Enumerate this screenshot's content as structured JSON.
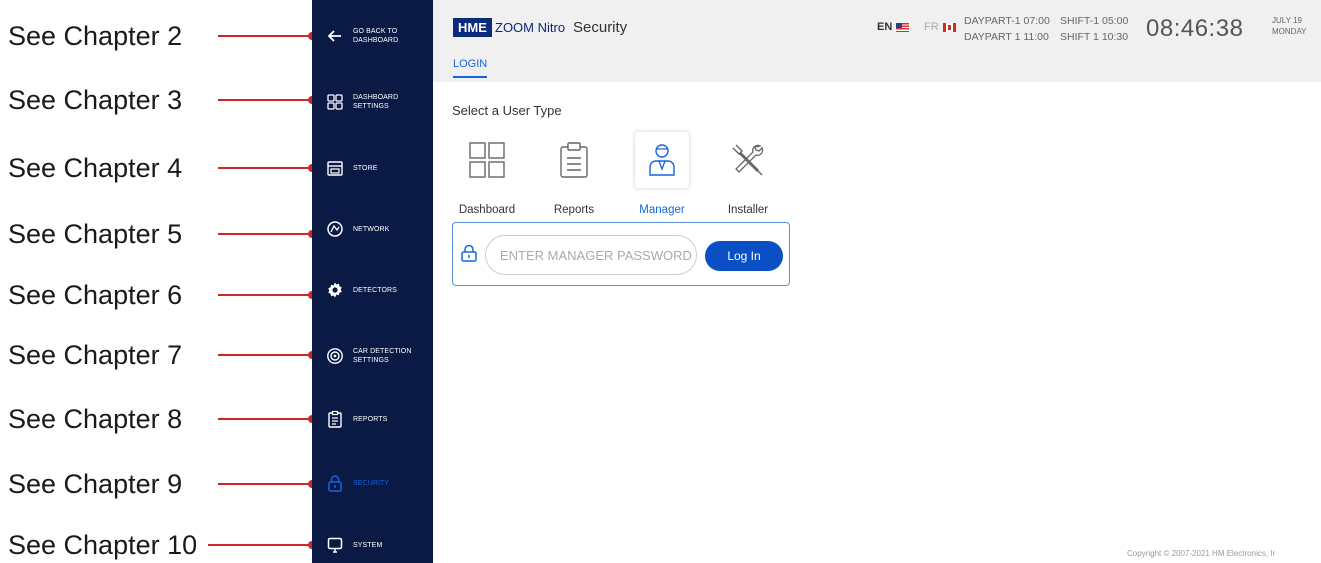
{
  "callouts": [
    {
      "label": "See Chapter 2"
    },
    {
      "label": "See Chapter 3"
    },
    {
      "label": "See Chapter 4"
    },
    {
      "label": "See Chapter 5"
    },
    {
      "label": "See Chapter 6"
    },
    {
      "label": "See Chapter 7"
    },
    {
      "label": "See Chapter 8"
    },
    {
      "label": "See Chapter 9"
    },
    {
      "label": "See Chapter 10"
    }
  ],
  "sidebar": {
    "items": [
      {
        "label": "GO BACK TO DASHBOARD",
        "icon": "arrow-left-icon"
      },
      {
        "label": "DASHBOARD SETTINGS",
        "icon": "grid-icon"
      },
      {
        "label": "STORE",
        "icon": "store-icon"
      },
      {
        "label": "NETWORK",
        "icon": "network-icon"
      },
      {
        "label": "DETECTORS",
        "icon": "gear-icon"
      },
      {
        "label": "CAR DETECTION SETTINGS",
        "icon": "target-icon"
      },
      {
        "label": "REPORTS",
        "icon": "clipboard-icon"
      },
      {
        "label": "SECURITY",
        "icon": "lock-icon",
        "active": true
      },
      {
        "label": "SYSTEM",
        "icon": "monitor-icon"
      }
    ]
  },
  "header": {
    "brand": "HME",
    "product": "ZOOM Nitro",
    "title": "Security",
    "tab": "LOGIN",
    "lang_en": "EN",
    "lang_fr": "FR",
    "daypart_line1": "DAYPART-1 07:00",
    "daypart_line2": "DAYPART 1 11:00",
    "shift_line1": "SHIFT-1 05:00",
    "shift_line2": "SHIFT 1 10:30",
    "time": "08:46:38",
    "date_line1": "JULY 19",
    "date_line2": "MONDAY"
  },
  "main": {
    "select_title": "Select a User Type",
    "user_types": [
      {
        "label": "Dashboard",
        "icon": "dashboard-grid-icon"
      },
      {
        "label": "Reports",
        "icon": "clipboard-icon"
      },
      {
        "label": "Manager",
        "icon": "manager-icon",
        "selected": true
      },
      {
        "label": "Installer",
        "icon": "tools-icon"
      }
    ],
    "password_placeholder": "ENTER MANAGER PASSWORD",
    "login_label": "Log In"
  },
  "footer": {
    "copyright": "Copyright © 2007-2021 HM Electronics, Ir"
  },
  "colors": {
    "sidebar_bg": "#0a1a44",
    "accent": "#1565e0",
    "callout_line": "#d0262b"
  }
}
